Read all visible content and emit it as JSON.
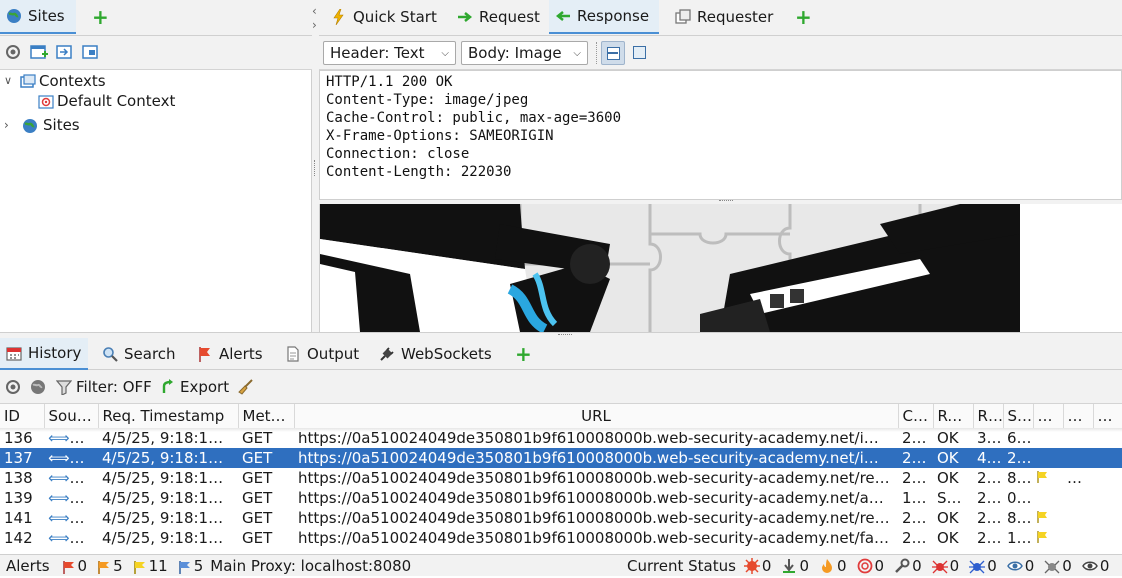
{
  "sites_panel": {
    "tab_label": "Sites",
    "tree": {
      "contexts_label": "Contexts",
      "default_context_label": "Default Context",
      "sites_label": "Sites"
    }
  },
  "workspace_tabs": [
    {
      "label": "Quick Start"
    },
    {
      "label": "Request"
    },
    {
      "label": "Response"
    },
    {
      "label": "Requester"
    }
  ],
  "response_toolbar": {
    "header_select": "Header: Text",
    "body_select": "Body: Image"
  },
  "response_headers": [
    "HTTP/1.1 200 OK",
    "Content-Type: image/jpeg",
    "Cache-Control: public, max-age=3600",
    "X-Frame-Options: SAMEORIGIN",
    "Connection: close",
    "Content-Length: 222030"
  ],
  "bottom_tabs": [
    {
      "label": "History"
    },
    {
      "label": "Search"
    },
    {
      "label": "Alerts"
    },
    {
      "label": "Output"
    },
    {
      "label": "WebSockets"
    }
  ],
  "history_toolbar": {
    "filter_label": "Filter: OFF",
    "export_label": "Export"
  },
  "history_table": {
    "columns": [
      "ID",
      "Sou…",
      "Req. Timestamp",
      "Met…",
      "URL",
      "C…",
      "Re…",
      "R…",
      "Si…",
      "…",
      "…",
      "…"
    ],
    "rows": [
      {
        "id": "136",
        "source": "P…",
        "timestamp": "4/5/25, 9:18:1…",
        "method": "GET",
        "url": "https://0a510024049de350801b9f610008000b.web-security-academy.net/i…",
        "code": "200",
        "reason": "OK",
        "rtt": "3…",
        "size": "6…",
        "flag": ""
      },
      {
        "id": "137",
        "source": "P…",
        "timestamp": "4/5/25, 9:18:1…",
        "method": "GET",
        "url": "https://0a510024049de350801b9f610008000b.web-security-academy.net/i…",
        "code": "200",
        "reason": "OK",
        "rtt": "4…",
        "size": "2…",
        "flag": ""
      },
      {
        "id": "138",
        "source": "P…",
        "timestamp": "4/5/25, 9:18:1…",
        "method": "GET",
        "url": "https://0a510024049de350801b9f610008000b.web-security-academy.net/re…",
        "code": "200",
        "reason": "OK",
        "rtt": "2…",
        "size": "8…",
        "flag": "…"
      },
      {
        "id": "139",
        "source": "P…",
        "timestamp": "4/5/25, 9:18:1…",
        "method": "GET",
        "url": "https://0a510024049de350801b9f610008000b.web-security-academy.net/a…",
        "code": "101",
        "reason": "S…",
        "rtt": "2…",
        "size": "0…",
        "flag": ""
      },
      {
        "id": "141",
        "source": "P…",
        "timestamp": "4/5/25, 9:18:1…",
        "method": "GET",
        "url": "https://0a510024049de350801b9f610008000b.web-security-academy.net/re…",
        "code": "200",
        "reason": "OK",
        "rtt": "2…",
        "size": "8…",
        "flag": ""
      },
      {
        "id": "142",
        "source": "P…",
        "timestamp": "4/5/25, 9:18:1…",
        "method": "GET",
        "url": "https://0a510024049de350801b9f610008000b.web-security-academy.net/fa…",
        "code": "200",
        "reason": "OK",
        "rtt": "2…",
        "size": "1…",
        "flag": ""
      }
    ],
    "selected_row": "137"
  },
  "status_bar": {
    "alerts_label": "Alerts",
    "alerts_high": "0",
    "alerts_medium": "5",
    "alerts_low": "11",
    "alerts_info": "5",
    "main_proxy": "Main Proxy: localhost:8080",
    "current_status_label": "Current Status",
    "counts": [
      "0",
      "0",
      "0",
      "0",
      "0",
      "0",
      "0",
      "0",
      "0",
      "0"
    ]
  },
  "colors": {
    "accent": "#2f6fbf",
    "add_green": "#2fa82f"
  }
}
